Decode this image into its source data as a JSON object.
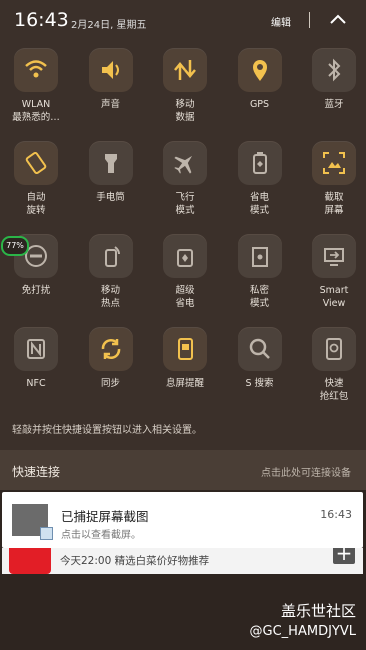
{
  "status": {
    "time": "16:43",
    "date": "2月24日, 星期五",
    "edit_label": "编辑",
    "collapse_icon": "chevron-up-icon"
  },
  "tiles": [
    {
      "label": "WLAN\n最熟悉的…",
      "icon": "wifi-icon",
      "active": true
    },
    {
      "label": "声音",
      "icon": "volume-icon",
      "active": true
    },
    {
      "label": "移动\n数据",
      "icon": "mobile-data-icon",
      "active": true
    },
    {
      "label": "GPS",
      "icon": "location-icon",
      "active": true
    },
    {
      "label": "蓝牙",
      "icon": "bluetooth-icon",
      "active": false
    },
    {
      "label": "自动\n旋转",
      "icon": "rotate-icon",
      "active": true
    },
    {
      "label": "手电筒",
      "icon": "flashlight-icon",
      "active": false
    },
    {
      "label": "飞行\n模式",
      "icon": "airplane-icon",
      "active": false
    },
    {
      "label": "省电\n模式",
      "icon": "battery-saver-icon",
      "active": false
    },
    {
      "label": "截取\n屏幕",
      "icon": "screenshot-icon",
      "active": true
    },
    {
      "label": "免打扰",
      "icon": "do-not-disturb-icon",
      "active": false
    },
    {
      "label": "移动\n热点",
      "icon": "hotspot-icon",
      "active": false
    },
    {
      "label": "超级\n省电",
      "icon": "ultra-power-saving-icon",
      "active": false
    },
    {
      "label": "私密\n模式",
      "icon": "private-mode-icon",
      "active": false
    },
    {
      "label": "Smart\nView",
      "icon": "smart-view-icon",
      "active": false
    },
    {
      "label": "NFC",
      "icon": "nfc-icon",
      "active": false
    },
    {
      "label": "同步",
      "icon": "sync-icon",
      "active": true
    },
    {
      "label": "息屏提醒",
      "icon": "always-on-display-icon",
      "active": true
    },
    {
      "label": "S 搜索",
      "icon": "search-icon",
      "active": false
    },
    {
      "label": "快速\n抢红包",
      "icon": "red-envelope-icon",
      "active": false
    }
  ],
  "badge": "77%",
  "hint": "轻敲并按住快捷设置按钮以进入相关设置。",
  "quick_connect": {
    "title": "快速连接",
    "hint": "点击此处可连接设备"
  },
  "notification": {
    "title": "已捕捉屏幕截图",
    "subtitle": "点击以查看截屏。",
    "time": "16:43"
  },
  "notification2": {
    "text": "今天22:00  精选白菜价好物推荐",
    "action": "+"
  },
  "watermark": {
    "line1": "盖乐世社区",
    "line2": "@GC_HAMDJYVL"
  },
  "colors": {
    "active_icon": "#f2c14e",
    "inactive_icon": "#bdb4aa"
  }
}
